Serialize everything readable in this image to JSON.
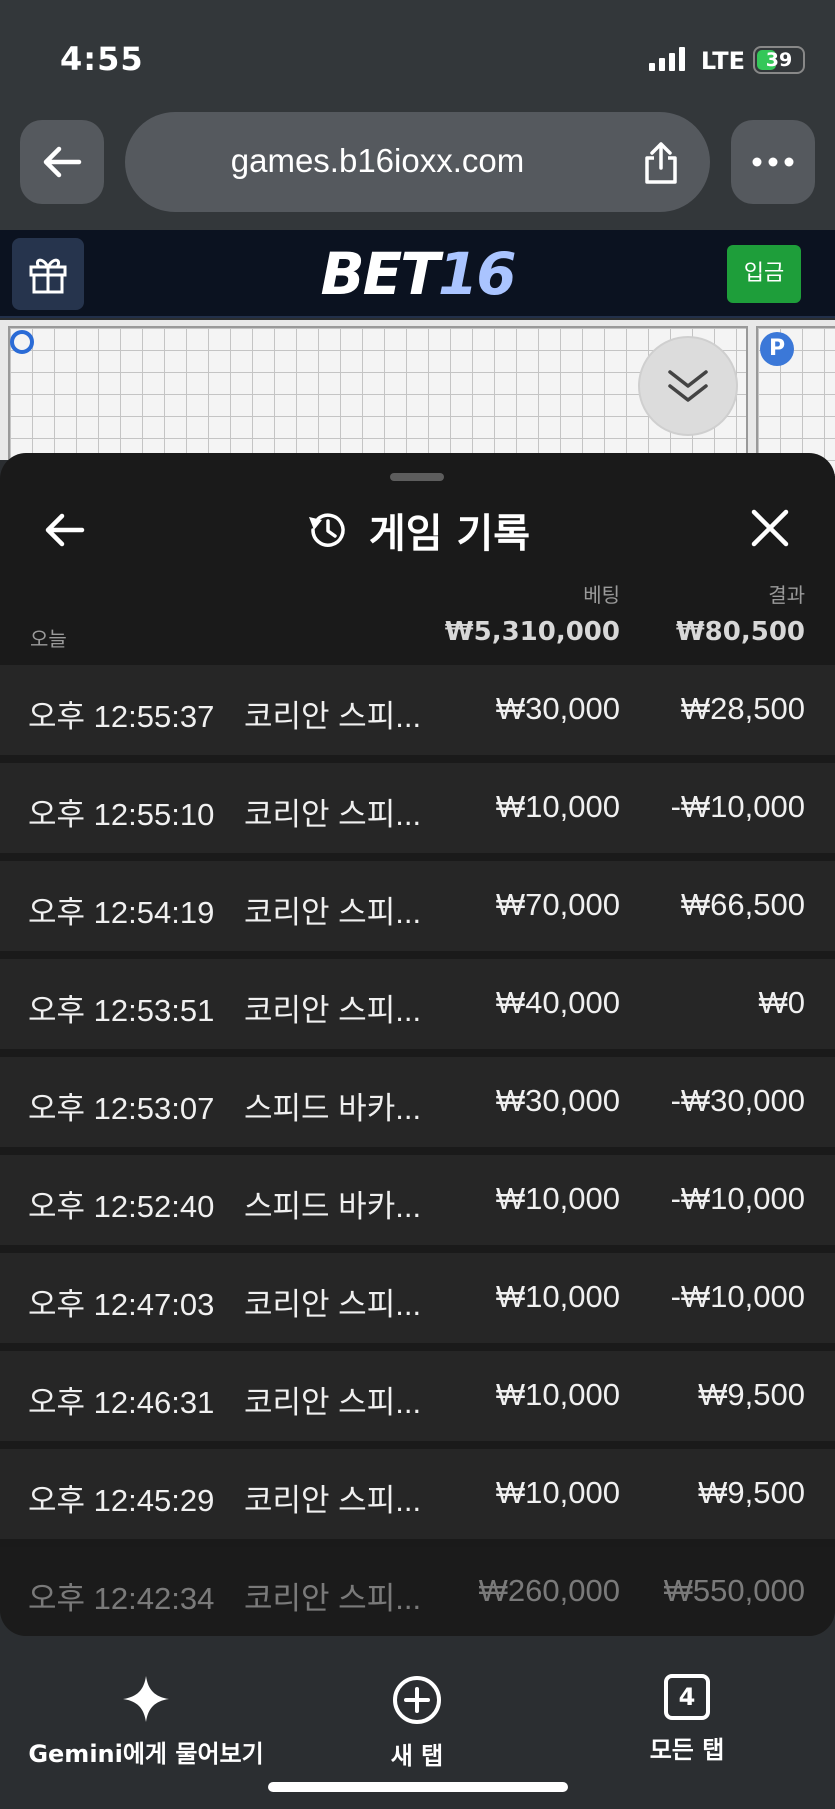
{
  "status_bar": {
    "time": "4:55",
    "network": "LTE",
    "battery": "39",
    "battery_level": 0.39
  },
  "browser": {
    "url": "games.b16ioxx.com"
  },
  "site": {
    "logo_part1": "BET",
    "logo_part2": "16",
    "deposit_label": "입금"
  },
  "game": {
    "o_mark": "",
    "p_mark": "P"
  },
  "history": {
    "title": "게임 기록",
    "col_bet": "베팅",
    "col_result": "결과",
    "today_label": "오늘",
    "total_bet": "₩5,310,000",
    "total_result": "₩80,500",
    "rows": [
      {
        "time": "오후 12:55:37",
        "game": "코리안 스피...",
        "bet": "₩30,000",
        "result": "₩28,500"
      },
      {
        "time": "오후 12:55:10",
        "game": "코리안 스피...",
        "bet": "₩10,000",
        "result": "-₩10,000"
      },
      {
        "time": "오후 12:54:19",
        "game": "코리안 스피...",
        "bet": "₩70,000",
        "result": "₩66,500"
      },
      {
        "time": "오후 12:53:51",
        "game": "코리안 스피...",
        "bet": "₩40,000",
        "result": "₩0"
      },
      {
        "time": "오후 12:53:07",
        "game": "스피드 바카...",
        "bet": "₩30,000",
        "result": "-₩30,000"
      },
      {
        "time": "오후 12:52:40",
        "game": "스피드 바카...",
        "bet": "₩10,000",
        "result": "-₩10,000"
      },
      {
        "time": "오후 12:47:03",
        "game": "코리안 스피...",
        "bet": "₩10,000",
        "result": "-₩10,000"
      },
      {
        "time": "오후 12:46:31",
        "game": "코리안 스피...",
        "bet": "₩10,000",
        "result": "₩9,500"
      },
      {
        "time": "오후 12:45:29",
        "game": "코리안 스피...",
        "bet": "₩10,000",
        "result": "₩9,500"
      },
      {
        "time": "오후 12:42:34",
        "game": "코리안 스피...",
        "bet": "₩260,000",
        "result": "₩550,000"
      }
    ]
  },
  "bottom_bar": {
    "gemini_label": "Gemini에게 물어보기",
    "new_tab_label": "새 탭",
    "all_tabs_label": "모든 탭",
    "tab_count": "4"
  },
  "colors": {
    "deposit": "#1e9e3a",
    "logo_accent": "#aac4ff",
    "panel_bg": "#1a1a1a",
    "row_bg": "#262626"
  }
}
